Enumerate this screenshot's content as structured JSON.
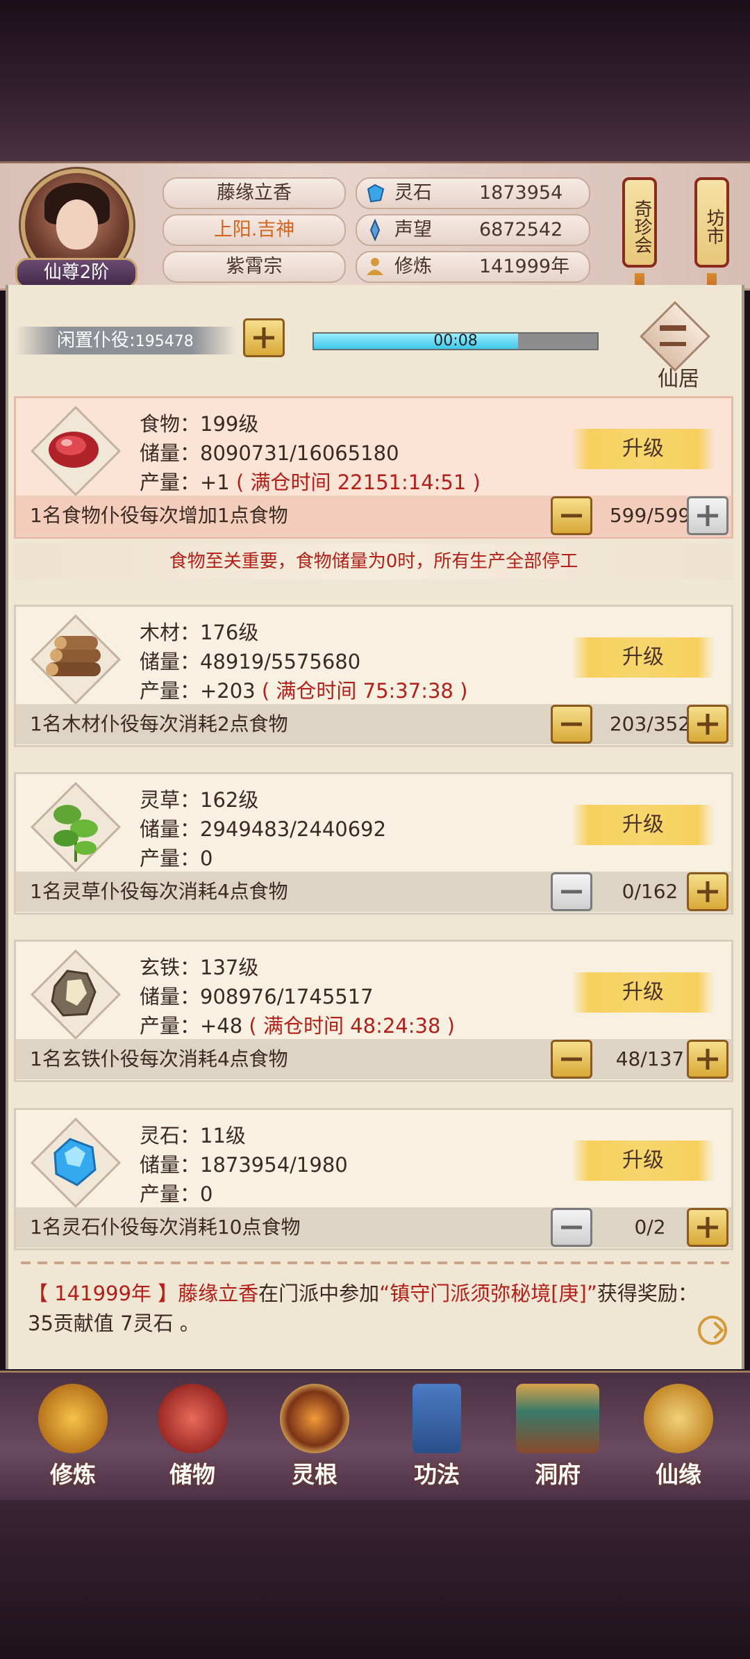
{
  "player": {
    "name": "藤缘立香",
    "title": "上阳.吉神",
    "sect": "紫霄宗",
    "rank": "仙尊2阶"
  },
  "stats": [
    {
      "label": "灵石",
      "value": "1873954",
      "icon": "spirit-stone-icon",
      "color": "#3aa6e8"
    },
    {
      "label": "声望",
      "value": "6872542",
      "icon": "prestige-crystal-icon",
      "color": "#5aa0d8"
    },
    {
      "label": "修炼",
      "value": "141999年",
      "icon": "cultivator-icon",
      "color": "#d79a3a"
    }
  ],
  "lanterns": {
    "treasure": "奇珍会",
    "market": "坊市"
  },
  "idle": {
    "label": "闲置仆役:",
    "count": "195478",
    "timer": "00:08",
    "progress": 0.72
  },
  "home": {
    "label": "仙居"
  },
  "resources": [
    {
      "name": "食物：199级",
      "storage": "储量：8090731/16065180",
      "output_prefix": "产量：+1",
      "full_time": "( 满仓时间 22151:14:51 )",
      "worker_desc": "1名食物仆役每次增加1点食物",
      "workers": "599/599",
      "upgrade": "升级",
      "icon": "meat-icon"
    },
    {
      "name": "木材：176级",
      "storage": "储量：48919/5575680",
      "output_prefix": "产量：+203",
      "full_time": "( 满仓时间 75:37:38 )",
      "worker_desc": "1名木材仆役每次消耗2点食物",
      "workers": "203/352",
      "upgrade": "升级",
      "icon": "wood-logs-icon"
    },
    {
      "name": "灵草：162级",
      "storage": "储量：2949483/2440692",
      "output_prefix": "产量：0",
      "full_time": "",
      "worker_desc": "1名灵草仆役每次消耗4点食物",
      "workers": "0/162",
      "upgrade": "升级",
      "icon": "herb-icon"
    },
    {
      "name": "玄铁：137级",
      "storage": "储量：908976/1745517",
      "output_prefix": "产量：+48",
      "full_time": "( 满仓时间 48:24:38 )",
      "worker_desc": "1名玄铁仆役每次消耗4点食物",
      "workers": "48/137",
      "upgrade": "升级",
      "icon": "iron-ore-icon"
    },
    {
      "name": "灵石：11级",
      "storage": "储量：1873954/1980",
      "output_prefix": "产量：0",
      "full_time": "",
      "worker_desc": "1名灵石仆役每次消耗10点食物",
      "workers": "0/2",
      "upgrade": "升级",
      "icon": "blue-crystal-icon"
    }
  ],
  "warning": "食物至关重要，食物储量为0时，所有生产全部停工",
  "news": {
    "year": "【 141999年 】",
    "name": "藤缘立香",
    "middle": "在门派中参加",
    "event": "“镇守门派须弥秘境[庚]”",
    "reward": "获得奖励：35贡献值 7灵石 。"
  },
  "nav": [
    {
      "label": "修炼",
      "icon": "cultivate-icon"
    },
    {
      "label": "储物",
      "icon": "storage-bag-icon"
    },
    {
      "label": "灵根",
      "icon": "spirit-root-icon"
    },
    {
      "label": "功法",
      "icon": "technique-book-icon"
    },
    {
      "label": "洞府",
      "icon": "cave-dwelling-icon"
    },
    {
      "label": "仙缘",
      "icon": "gourd-icon"
    }
  ]
}
